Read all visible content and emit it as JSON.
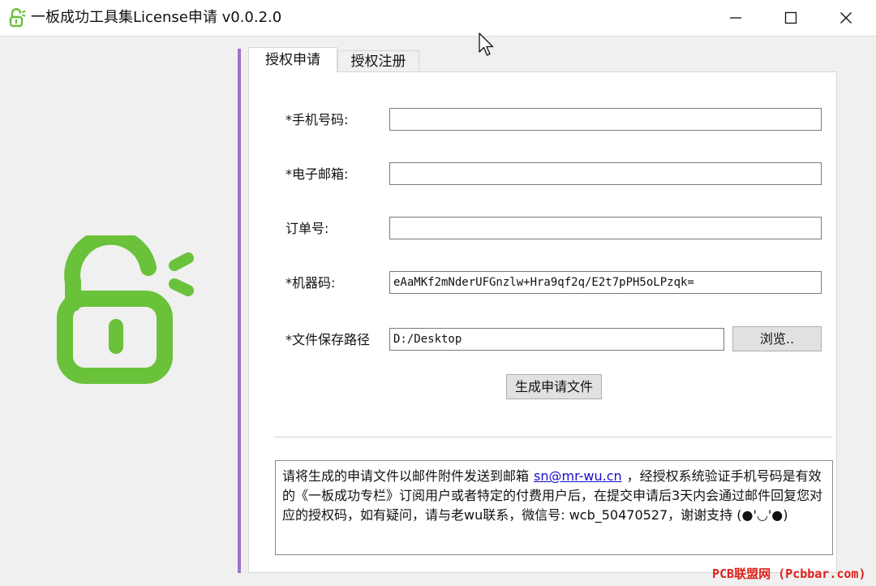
{
  "window": {
    "title": "一板成功工具集License申请 v0.0.2.0",
    "controls": {
      "minimize": "minimize",
      "maximize": "maximize",
      "close": "close"
    }
  },
  "icons": {
    "app_icon": "unlocked-padlock-icon",
    "big_lock": "unlocked-padlock-icon",
    "lock_color": "#6ac13a"
  },
  "accent_color": "#9b73c8",
  "tabs": [
    {
      "label": "授权申请",
      "active": true
    },
    {
      "label": "授权注册",
      "active": false
    }
  ],
  "form": {
    "phone": {
      "label": "*手机号码:",
      "value": ""
    },
    "email": {
      "label": "*电子邮箱:",
      "value": ""
    },
    "order": {
      "label": "订单号:",
      "value": ""
    },
    "machine": {
      "label": "*机器码:",
      "value": "eAaMKf2mNderUFGnzlw+Hra9qf2q/E2t7pPH5oLPzqk="
    },
    "save_path": {
      "label": "*文件保存路径",
      "value": "D:/Desktop"
    },
    "browse_label": "浏览..",
    "generate_label": "生成申请文件"
  },
  "notice": {
    "part1": "请将生成的申请文件以邮件附件发送到邮箱",
    "email": "sn@mr-wu.cn",
    "part2": "，经授权系统验证手机号码是有效的《一板成功专栏》订阅用户或者特定的付费用户后，在提交申请后3天内会通过邮件回复您对应的授权码，如有疑问，请与老wu联系，微信号: wcb_50470527，谢谢支持 (●'◡'●)"
  },
  "watermark": "PCB联盟网 (Pcbbar.com)"
}
